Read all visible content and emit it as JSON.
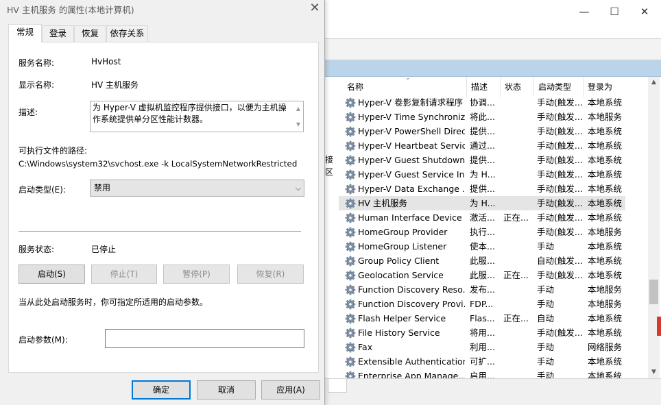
{
  "dialog": {
    "title": "HV 主机服务 的属性(本地计算机)",
    "close_glyph": "✕",
    "tabs": [
      "常规",
      "登录",
      "恢复",
      "依存关系"
    ],
    "fields": {
      "service_name_label": "服务名称:",
      "service_name_value": "HvHost",
      "display_name_label": "显示名称:",
      "display_name_value": "HV 主机服务",
      "description_label": "描述:",
      "description_value": "为 Hyper-V 虚拟机监控程序提供接口，以便为主机操作系统提供单分区性能计数器。",
      "path_label": "可执行文件的路径:",
      "path_value": "C:\\Windows\\system32\\svchost.exe -k LocalSystemNetworkRestricted",
      "startup_type_label": "启动类型(E):",
      "startup_type_value": "禁用",
      "status_label": "服务状态:",
      "status_value": "已停止",
      "hint_text": "当从此处启动服务时，你可指定所适用的启动参数。",
      "params_label": "启动参数(M):",
      "params_value": ""
    },
    "buttons": {
      "start": "启动(S)",
      "stop": "停止(T)",
      "pause": "暂停(P)",
      "resume": "恢复(R)",
      "ok": "确定",
      "cancel": "取消",
      "apply": "应用(A)"
    }
  },
  "services_window": {
    "window_buttons": {
      "minimize": "—",
      "maximize": "☐",
      "close": "✕"
    },
    "left_pane_text": [
      "接",
      "区"
    ],
    "columns": [
      "名称",
      "描述",
      "状态",
      "启动类型",
      "登录为"
    ],
    "sort_indicator": "⌄",
    "rows": [
      {
        "name": "Hyper-V 卷影复制请求程序",
        "desc": "协调...",
        "status": "",
        "start": "手动(触发...",
        "logon": "本地系统"
      },
      {
        "name": "Hyper-V Time Synchronizat...",
        "desc": "将此...",
        "status": "",
        "start": "手动(触发...",
        "logon": "本地服务"
      },
      {
        "name": "Hyper-V PowerShell Direct ...",
        "desc": "提供...",
        "status": "",
        "start": "手动(触发...",
        "logon": "本地系统"
      },
      {
        "name": "Hyper-V Heartbeat Service",
        "desc": "通过...",
        "status": "",
        "start": "手动(触发...",
        "logon": "本地系统"
      },
      {
        "name": "Hyper-V Guest Shutdown ...",
        "desc": "提供...",
        "status": "",
        "start": "手动(触发...",
        "logon": "本地系统"
      },
      {
        "name": "Hyper-V Guest Service In...",
        "desc": "为 H...",
        "status": "",
        "start": "手动(触发...",
        "logon": "本地系统"
      },
      {
        "name": "Hyper-V Data Exchange ...",
        "desc": "提供...",
        "status": "",
        "start": "手动(触发...",
        "logon": "本地系统"
      },
      {
        "name": "HV 主机服务",
        "desc": "为 H...",
        "status": "",
        "start": "手动(触发...",
        "logon": "本地系统",
        "selected": true
      },
      {
        "name": "Human Interface Device ...",
        "desc": "激活...",
        "status": "正在...",
        "start": "手动(触发...",
        "logon": "本地系统"
      },
      {
        "name": "HomeGroup Provider",
        "desc": "执行...",
        "status": "",
        "start": "手动(触发...",
        "logon": "本地服务"
      },
      {
        "name": "HomeGroup Listener",
        "desc": "使本...",
        "status": "",
        "start": "手动",
        "logon": "本地系统"
      },
      {
        "name": "Group Policy Client",
        "desc": "此服...",
        "status": "",
        "start": "自动(触发...",
        "logon": "本地系统"
      },
      {
        "name": "Geolocation Service",
        "desc": "此服...",
        "status": "正在...",
        "start": "手动(触发...",
        "logon": "本地系统"
      },
      {
        "name": "Function Discovery Reso...",
        "desc": "发布...",
        "status": "",
        "start": "手动",
        "logon": "本地服务"
      },
      {
        "name": "Function Discovery Provi...",
        "desc": "FDP...",
        "status": "",
        "start": "手动",
        "logon": "本地服务"
      },
      {
        "name": "Flash Helper Service",
        "desc": "Flas...",
        "status": "正在...",
        "start": "自动",
        "logon": "本地系统"
      },
      {
        "name": "File History Service",
        "desc": "将用...",
        "status": "",
        "start": "手动(触发...",
        "logon": "本地系统"
      },
      {
        "name": "Fax",
        "desc": "利用...",
        "status": "",
        "start": "手动",
        "logon": "网络服务"
      },
      {
        "name": "Extensible Authentication...",
        "desc": "可扩...",
        "status": "",
        "start": "手动",
        "logon": "本地系统"
      },
      {
        "name": "Enterprise App Manage...",
        "desc": "启用...",
        "status": "",
        "start": "手动",
        "logon": "本地系统"
      }
    ],
    "scroll_up": "▲",
    "scroll_down": "▼"
  },
  "colors": {
    "dialog_bg": "#f0f0f0",
    "header_band": "#bcd4e9",
    "selected_row": "#e5e5e5",
    "primary_border": "#0078d7"
  },
  "icons": [
    "close-icon",
    "gear-icon",
    "chevron-down-icon",
    "minimize-icon",
    "maximize-icon"
  ]
}
